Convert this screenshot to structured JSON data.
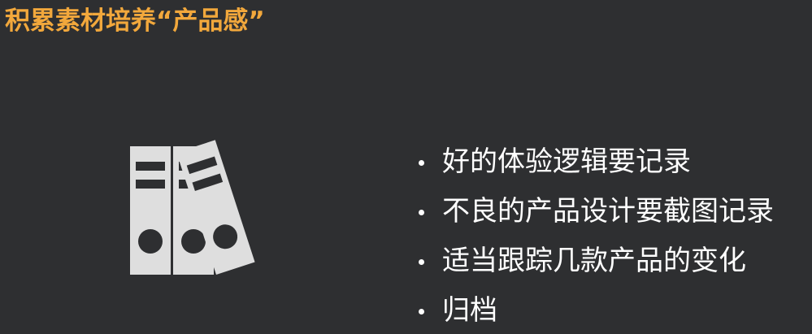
{
  "slide": {
    "title": "积累素材培养“产品感”",
    "illustration_icon": "binders-icon",
    "bullets": [
      "好的体验逻辑要记录",
      "不良的产品设计要截图记录",
      "适当跟踪几款产品的变化",
      "归档"
    ]
  },
  "colors": {
    "background": "#2e2f31",
    "title": "#f2a83c",
    "text": "#ffffff",
    "illustration": "#dedede"
  }
}
